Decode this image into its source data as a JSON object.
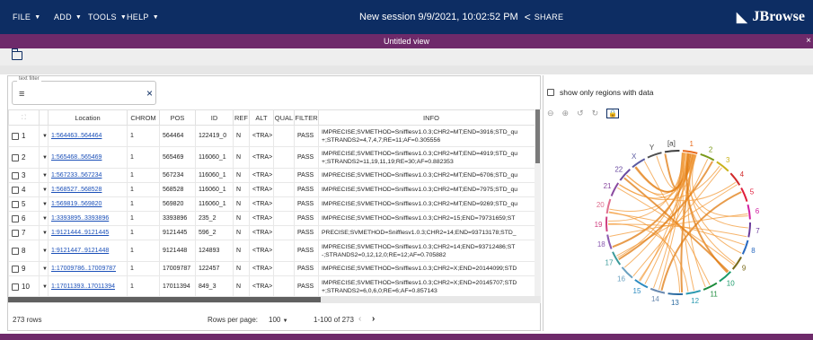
{
  "menubar": {
    "items": [
      {
        "label": "FILE"
      },
      {
        "label": "ADD"
      },
      {
        "label": "TOOLS"
      },
      {
        "label": "HELP"
      }
    ],
    "session_title": "New session 9/9/2021, 10:02:52 PM",
    "share_label": "SHARE",
    "brand": "JBrowse"
  },
  "view": {
    "title": "Untitled view",
    "close_glyph": "×"
  },
  "filter": {
    "legend": "text filter",
    "value": "",
    "clear_glyph": "×"
  },
  "table": {
    "columns": [
      "",
      "",
      "Location",
      "CHROM",
      "POS",
      "ID",
      "REF",
      "ALT",
      "QUAL",
      "FILTER",
      "INFO"
    ],
    "rows": [
      {
        "num": "1",
        "loc": "1:564463..564464",
        "chrom": "1",
        "pos": "564464",
        "id": "122419_0",
        "ref": "N",
        "alt": "<TRA>",
        "qual": "",
        "filter": "PASS",
        "info": "IMPRECISE;SVMETHOD=Snifflesv1.0.3;CHR2=MT;END=3916;STD_qu +;STRANDS2=4,7,4,7;RE=11;AF=0.305556",
        "tall": true
      },
      {
        "num": "2",
        "loc": "1:565468..565469",
        "chrom": "1",
        "pos": "565469",
        "id": "116060_1",
        "ref": "N",
        "alt": "<TRA>",
        "qual": "",
        "filter": "PASS",
        "info": "IMPRECISE;SVMETHOD=Snifflesv1.0.3;CHR2=MT;END=4919;STD_qu +;STRANDS2=11,19,11,19;RE=30;AF=0.882353",
        "tall": true
      },
      {
        "num": "3",
        "loc": "1:567233..567234",
        "chrom": "1",
        "pos": "567234",
        "id": "116060_1",
        "ref": "N",
        "alt": "<TRA>",
        "qual": "",
        "filter": "PASS",
        "info": "IMPRECISE;SVMETHOD=Snifflesv1.0.3;CHR2=MT;END=6706;STD_qu",
        "tall": false
      },
      {
        "num": "4",
        "loc": "1:568527..568528",
        "chrom": "1",
        "pos": "568528",
        "id": "116060_1",
        "ref": "N",
        "alt": "<TRA>",
        "qual": "",
        "filter": "PASS",
        "info": "IMPRECISE;SVMETHOD=Snifflesv1.0.3;CHR2=MT;END=7975;STD_qu",
        "tall": false
      },
      {
        "num": "5",
        "loc": "1:569819..569820",
        "chrom": "1",
        "pos": "569820",
        "id": "116060_1",
        "ref": "N",
        "alt": "<TRA>",
        "qual": "",
        "filter": "PASS",
        "info": "IMPRECISE;SVMETHOD=Snifflesv1.0.3;CHR2=MT;END=9269;STD_qu",
        "tall": false
      },
      {
        "num": "6",
        "loc": "1:3393895..3393896",
        "chrom": "1",
        "pos": "3393896",
        "id": "235_2",
        "ref": "N",
        "alt": "<TRA>",
        "qual": "",
        "filter": "PASS",
        "info": "IMPRECISE;SVMETHOD=Snifflesv1.0.3;CHR2=15;END=79731659;ST",
        "tall": false
      },
      {
        "num": "7",
        "loc": "1:9121444..9121445",
        "chrom": "1",
        "pos": "9121445",
        "id": "596_2",
        "ref": "N",
        "alt": "<TRA>",
        "qual": "",
        "filter": "PASS",
        "info": "PRECISE;SVMETHOD=Snifflesv1.0.3;CHR2=14;END=93713178;STD_",
        "tall": false
      },
      {
        "num": "8",
        "loc": "1:9121447..9121448",
        "chrom": "1",
        "pos": "9121448",
        "id": "124893",
        "ref": "N",
        "alt": "<TRA>",
        "qual": "",
        "filter": "PASS",
        "info": "IMPRECISE;SVMETHOD=Snifflesv1.0.3;CHR2=14;END=93712486;ST -;STRANDS2=0,12,12,0;RE=12;AF=0.705882",
        "tall": true
      },
      {
        "num": "9",
        "loc": "1:17009786..17009787",
        "chrom": "1",
        "pos": "17009787",
        "id": "122457",
        "ref": "N",
        "alt": "<TRA>",
        "qual": "",
        "filter": "PASS",
        "info": "IMPRECISE;SVMETHOD=Snifflesv1.0.3;CHR2=X;END=20144099;STD",
        "tall": false
      },
      {
        "num": "10",
        "loc": "1:17011393..17011394",
        "chrom": "1",
        "pos": "17011394",
        "id": "849_3",
        "ref": "N",
        "alt": "<TRA>",
        "qual": "",
        "filter": "PASS",
        "info": "IMPRECISE;SVMETHOD=Snifflesv1.0.3;CHR2=X;END=20145707;STD +;STRANDS2=6,0,6,0;RE=6;AF=0.857143",
        "tall": true
      }
    ]
  },
  "footer": {
    "row_count": "273 rows",
    "rows_per_page_label": "Rows per page:",
    "rows_per_page_value": "100",
    "range": "1-100 of 273"
  },
  "circular": {
    "show_regions_label": "show only regions with data",
    "chromosomes": [
      "1",
      "2",
      "3",
      "4",
      "5",
      "6",
      "7",
      "8",
      "9",
      "10",
      "11",
      "12",
      "13",
      "14",
      "15",
      "16",
      "17",
      "18",
      "19",
      "20",
      "21",
      "22",
      "X",
      "Y",
      "[a]"
    ],
    "colors": {
      "chord": "#f39b3a",
      "chord_dark": "#e07b10",
      "chr_label": "#7a2a7a"
    }
  },
  "colors": {
    "topbar": "#0d2d63",
    "viewbar": "#6e2a6a",
    "link": "#1a4fb8"
  }
}
